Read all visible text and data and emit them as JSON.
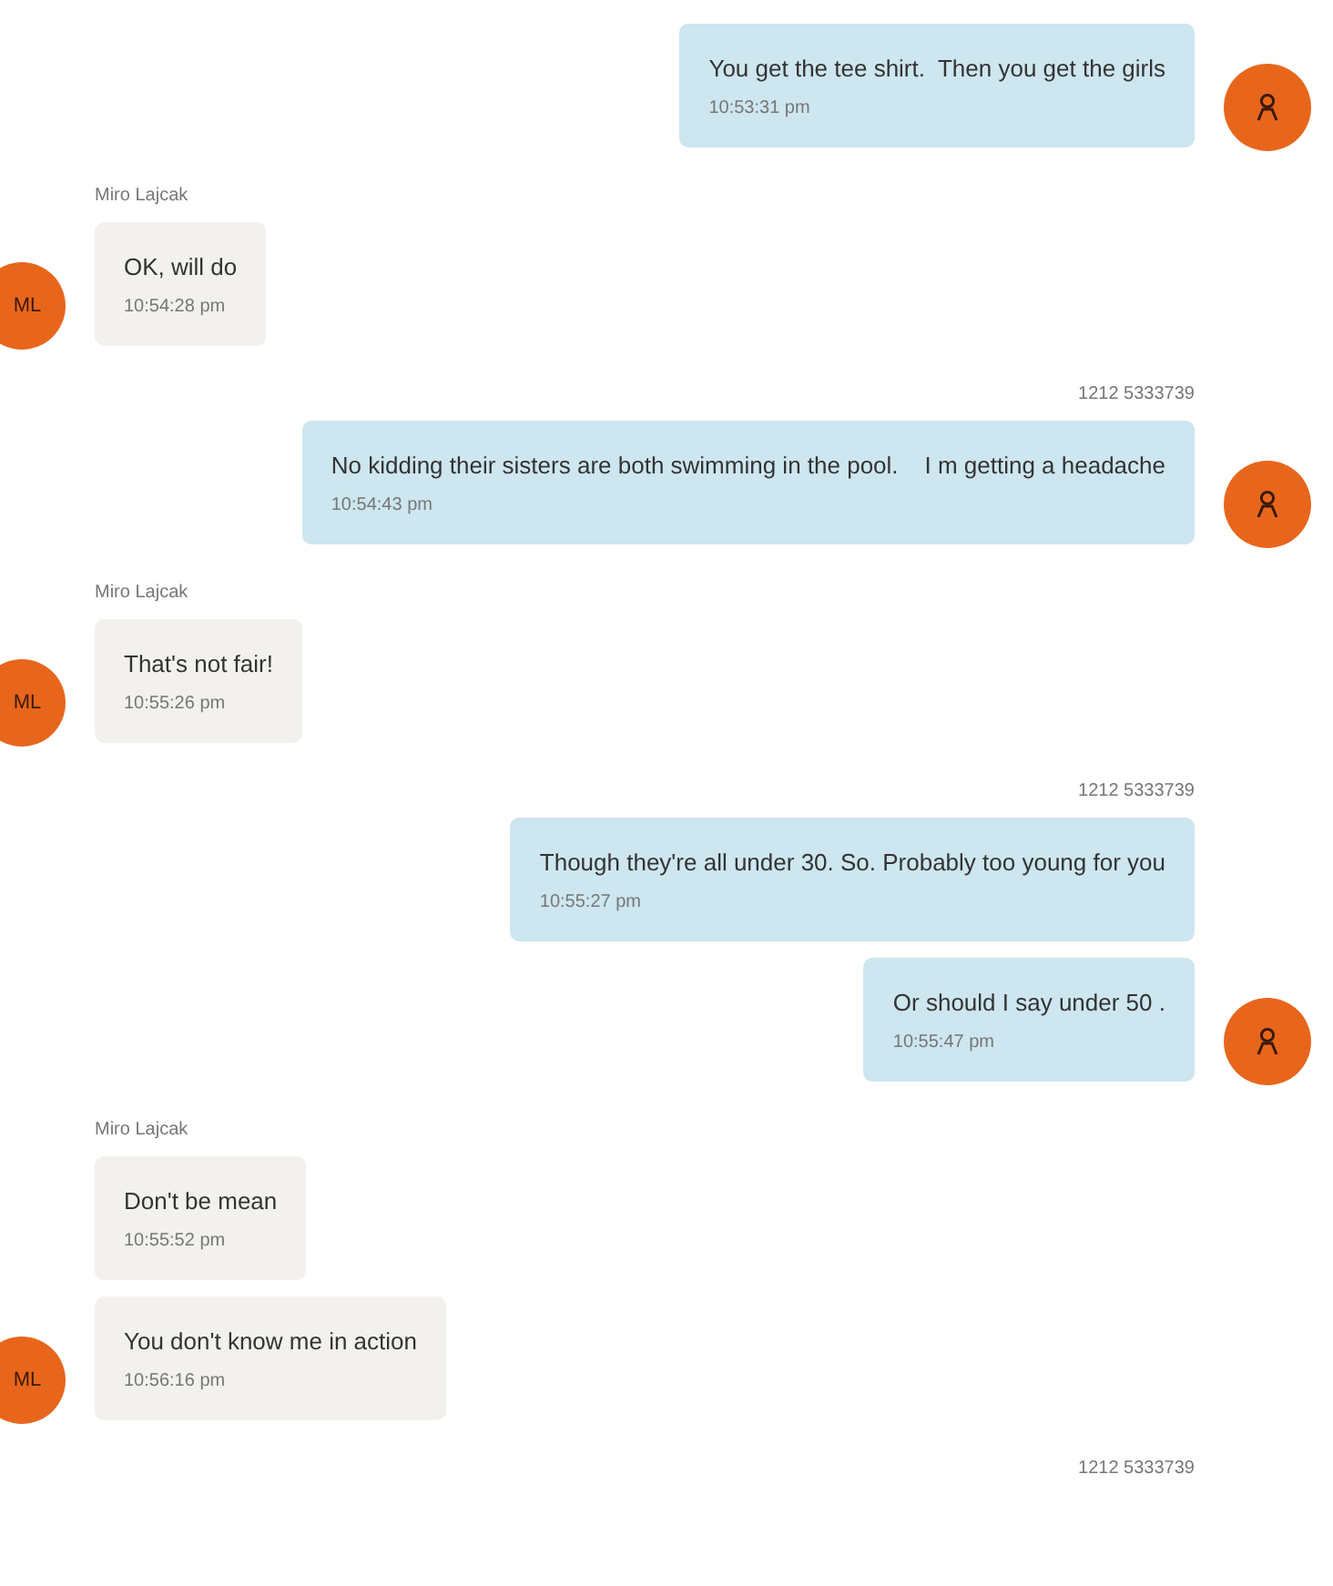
{
  "conversation": [
    {
      "kind": "outgoing",
      "messages": [
        {
          "text": "You get the tee shirt.  Then you get the girls",
          "time": "10:53:31 pm"
        }
      ]
    },
    {
      "kind": "incoming",
      "sender": "Miro Lajcak",
      "avatar": "ML",
      "messages": [
        {
          "text": "OK, will do",
          "time": "10:54:28 pm"
        }
      ]
    },
    {
      "kind": "outgoing",
      "sender": "1212 5333739",
      "messages": [
        {
          "text": "No kidding their sisters are both swimming in the pool.    I m getting a headache",
          "time": "10:54:43 pm"
        }
      ]
    },
    {
      "kind": "incoming",
      "sender": "Miro Lajcak",
      "avatar": "ML",
      "messages": [
        {
          "text": "That's not fair!",
          "time": "10:55:26 pm"
        }
      ]
    },
    {
      "kind": "outgoing",
      "sender": "1212 5333739",
      "messages": [
        {
          "text": "Though they're all under 30. So. Probably too young for you",
          "time": "10:55:27 pm"
        },
        {
          "text": "Or should I say under 50 .",
          "time": "10:55:47 pm"
        }
      ]
    },
    {
      "kind": "incoming",
      "sender": "Miro Lajcak",
      "avatar": "ML",
      "messages": [
        {
          "text": "Don't be mean",
          "time": "10:55:52 pm"
        },
        {
          "text": "You don't know me in action",
          "time": "10:56:16 pm"
        }
      ]
    },
    {
      "kind": "outgoing",
      "sender": "1212 5333739"
    }
  ]
}
